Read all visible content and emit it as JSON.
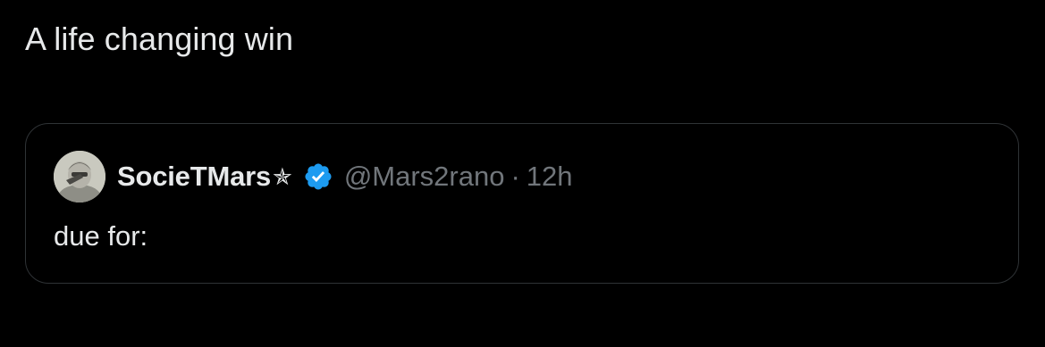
{
  "tweet": {
    "text": "A life changing win"
  },
  "quoted_tweet": {
    "display_name": "SocieTMars",
    "name_suffix_icon": "star-icon",
    "name_suffix_glyph": "✯",
    "verified_icon": "verified-badge-icon",
    "verified_color": "#1d9bf0",
    "handle": "@Mars2rano",
    "separator": "·",
    "timestamp": "12h",
    "text": "due for:"
  },
  "colors": {
    "background": "#000000",
    "primary_text": "#e7e9ea",
    "secondary_text": "#71767b",
    "border": "#2f3336"
  }
}
